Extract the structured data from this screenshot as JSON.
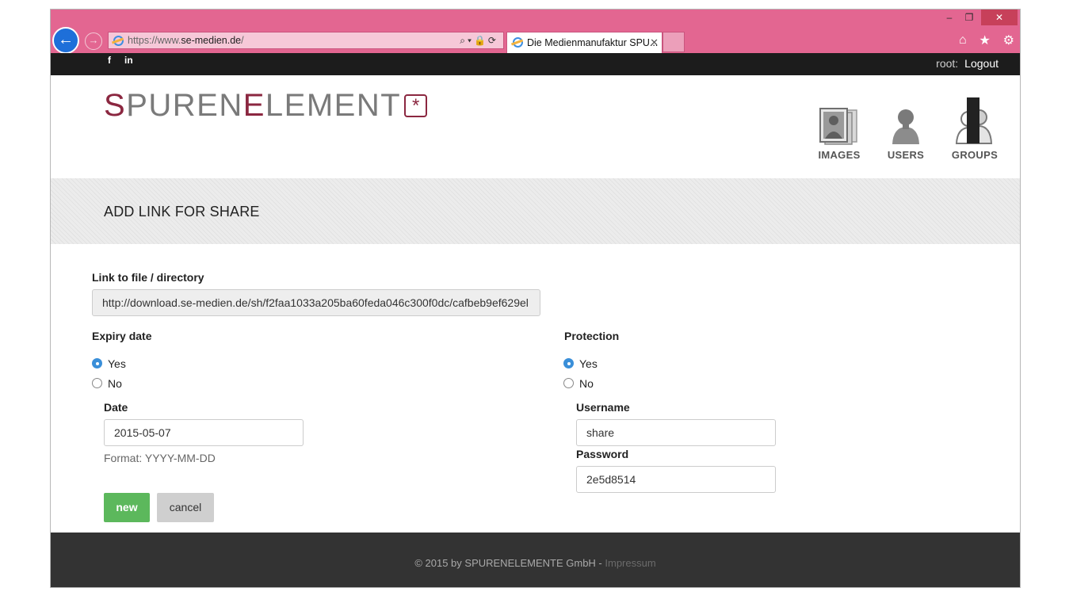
{
  "window_controls": {
    "minimize": "‒",
    "maximize": "❐",
    "close": "✕"
  },
  "browser": {
    "url_prefix": "https://www.",
    "url_domain": "se-medien.de",
    "url_suffix": "/",
    "address_tools": "⌕▾🔒⟳",
    "tab_title": "Die Medienmanufaktur SPU...",
    "tab_close": "✕",
    "home_icon": "⌂",
    "favorites_icon": "★",
    "settings_icon": "⚙",
    "back_icon": "←",
    "forward_icon": "→"
  },
  "topbar": {
    "facebook": "f",
    "linkedin": "in",
    "user": "root:",
    "logout": "Logout"
  },
  "logo": {
    "part1": "SPURENE",
    "red_letter_1": "",
    "part2": "LEMENT",
    "box_glyph": "*"
  },
  "nav": {
    "images": "IMAGES",
    "users": "USERS",
    "groups": "GROUPS"
  },
  "page_title": "ADD LINK FOR SHARE",
  "form": {
    "link_label": "Link to file / directory",
    "link_value": "http://download.se-medien.de/sh/f2faa1033a205ba60feda046c300f0dc/cafbeb9ef629el",
    "expiry_label": "Expiry date",
    "expiry_yes": "Yes",
    "expiry_no": "No",
    "expiry_selected": "Yes",
    "date_label": "Date",
    "date_value": "2015-05-07",
    "date_help": "Format: YYYY-MM-DD",
    "protection_label": "Protection",
    "protection_yes": "Yes",
    "protection_no": "No",
    "protection_selected": "Yes",
    "username_label": "Username",
    "username_value": "share",
    "password_label": "Password",
    "password_value": "2e5d8514",
    "new_button": "new",
    "cancel_button": "cancel"
  },
  "footer": {
    "copyright": "© 2015 by SPURENELEMENTE GmbH",
    "separator": " - ",
    "impressum": "Impressum"
  },
  "colors": {
    "browser_chrome": "#e36691",
    "brand_red": "#8b2740",
    "primary_green": "#5cb85c",
    "radio_blue": "#3a8fd9",
    "dark_bar": "#1c1c1c",
    "footer": "#333333"
  }
}
